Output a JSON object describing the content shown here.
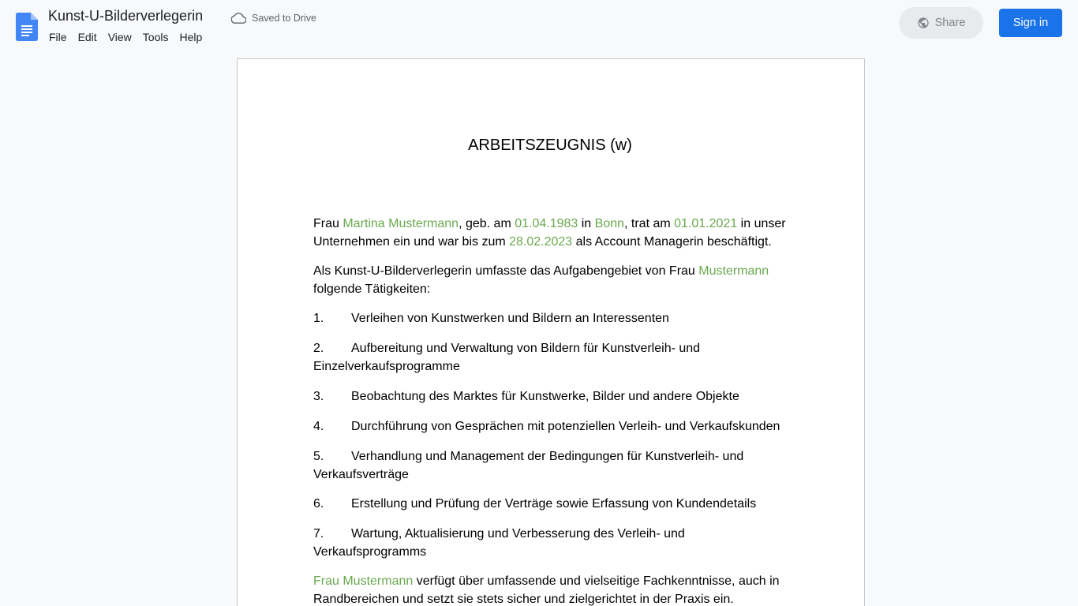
{
  "app": {
    "doc_title": "Kunst-U-Bilderverlegerin",
    "save_status": "Saved to Drive",
    "menu": [
      "File",
      "Edit",
      "View",
      "Tools",
      "Help"
    ],
    "share_label": "Share",
    "signin_label": "Sign in",
    "colors": {
      "accent": "#1a73e8",
      "highlight": "#6aa84f",
      "logo": "#4285f4"
    }
  },
  "document": {
    "heading": "ARBEITSZEUGNIS (w)",
    "intro": {
      "t1": "Frau ",
      "name": "Martina Mustermann",
      "t2": ", geb. am ",
      "birth_date": "01.04.1983",
      "t3": " in ",
      "city": "Bonn",
      "t4": ", trat am ",
      "start_date": "01.01.2021",
      "t5": " in unser Unternehmen ein und war bis zum ",
      "end_date": "28.02.2023",
      "t6": " als Account Managerin beschäftigt."
    },
    "scope": {
      "t1": "Als Kunst-U-Bilderverlegerin umfasste das Aufgabengebiet von Frau ",
      "name": "Mustermann",
      "t2": " folgende Tätigkeiten:"
    },
    "tasks": [
      {
        "number": "1.",
        "text": "Verleihen von Kunstwerken und Bildern an Interessenten"
      },
      {
        "number": "2.",
        "text": "Aufbereitung und Verwaltung von Bildern für Kunstverleih- und Einzelverkaufsprogramme"
      },
      {
        "number": "3.",
        "text": "Beobachtung des Marktes für Kunstwerke, Bilder und andere Objekte"
      },
      {
        "number": "4.",
        "text": "Durchführung von Gesprächen mit potenziellen Verleih- und Verkaufskunden"
      },
      {
        "number": "5.",
        "text": "Verhandlung und Management der Bedingungen für Kunstverleih- und Verkaufsverträge"
      },
      {
        "number": "6.",
        "text": "Erstellung und Prüfung der Verträge sowie Erfassung von Kundendetails"
      },
      {
        "number": "7.",
        "text": "Wartung, Aktualisierung und Verbesserung des Verleih- und Verkaufsprogramms"
      }
    ],
    "closing": {
      "name": "Frau Mustermann",
      "t1": " verfügt über umfassende und vielseitige Fachkenntnisse, auch in Randbereichen und setzt sie stets sicher und zielgerichtet in der Praxis ein."
    }
  }
}
